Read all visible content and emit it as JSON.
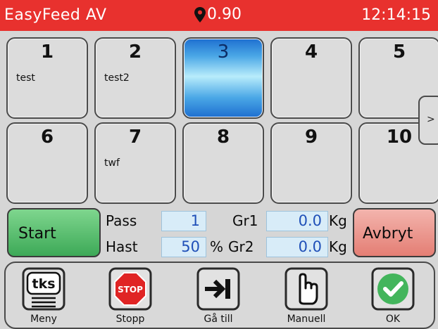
{
  "header": {
    "app_name": "EasyFeed AV",
    "location_value": "0.90",
    "time": "12:14:15"
  },
  "tiles": [
    {
      "number": "1",
      "label": "test"
    },
    {
      "number": "2",
      "label": "test2"
    },
    {
      "number": "3",
      "label": ""
    },
    {
      "number": "4",
      "label": ""
    },
    {
      "number": "5",
      "label": ""
    },
    {
      "number": "6",
      "label": ""
    },
    {
      "number": "7",
      "label": "twf"
    },
    {
      "number": "8",
      "label": ""
    },
    {
      "number": "9",
      "label": ""
    },
    {
      "number": "10",
      "label": ""
    }
  ],
  "selected_tile": "3",
  "next_page": ">",
  "controls": {
    "start_label": "Start",
    "abort_label": "Avbryt",
    "pass_label": "Pass",
    "pass_value": "1",
    "speed_label": "Hast",
    "speed_value": "50",
    "speed_unit": "%",
    "gr1_label": "Gr1",
    "gr1_value": "0.0",
    "gr2_label": "Gr2",
    "gr2_value": "0.0",
    "weight_unit": "Kg"
  },
  "toolbar": {
    "menu_label": "Meny",
    "menu_logo": "tks",
    "stop_label": "Stopp",
    "stop_sign_text": "STOP",
    "goto_label": "Gå till",
    "manual_label": "Manuell",
    "ok_label": "OK"
  },
  "colors": {
    "header_bg": "#e8312e",
    "selected_tile": "#4aa7e6",
    "start_button": "#3da957",
    "abort_button": "#e47e74",
    "field_text": "#2050b8"
  }
}
